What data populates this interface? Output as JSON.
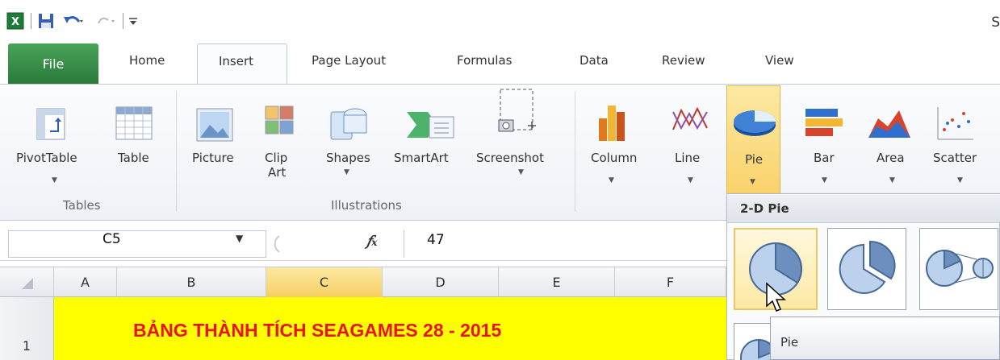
{
  "window": {
    "title_partial": "S"
  },
  "tabs": [
    {
      "label": "File",
      "id": "file"
    },
    {
      "label": "Home",
      "id": "home"
    },
    {
      "label": "Insert",
      "id": "insert"
    },
    {
      "label": "Page Layout",
      "id": "page-layout"
    },
    {
      "label": "Formulas",
      "id": "formulas"
    },
    {
      "label": "Data",
      "id": "data"
    },
    {
      "label": "Review",
      "id": "review"
    },
    {
      "label": "View",
      "id": "view"
    }
  ],
  "ribbon": {
    "tables_group": {
      "label": "Tables",
      "pivot": "PivotTable",
      "table": "Table"
    },
    "illustrations_group": {
      "label": "Illustrations",
      "picture": "Picture",
      "clipart_line1": "Clip",
      "clipart_line2": "Art",
      "shapes": "Shapes",
      "smartart": "SmartArt",
      "screenshot": "Screenshot"
    },
    "charts_group": {
      "column": "Column",
      "line": "Line",
      "pie": "Pie",
      "bar": "Bar",
      "area": "Area",
      "scatter": "Scatter"
    },
    "colors": {
      "pie_highlight": "#f9d26a",
      "ribbon_bg": "#eef2f7"
    }
  },
  "formula_bar": {
    "name_box": "C5",
    "fx": "fx",
    "value": "47"
  },
  "columns": [
    "A",
    "B",
    "C",
    "D",
    "E",
    "F"
  ],
  "selected_column": "C",
  "rows": [
    {
      "number": "1",
      "text": "BẢNG THÀNH TÍCH SEAGAMES 28 - 2015",
      "bg": "#ffff00",
      "color": "#e8141a"
    }
  ],
  "pie_dropdown": {
    "section_title": "2-D Pie",
    "options": [
      "pie",
      "exploded-pie",
      "pie-of-pie"
    ],
    "tooltip": "Pie"
  }
}
